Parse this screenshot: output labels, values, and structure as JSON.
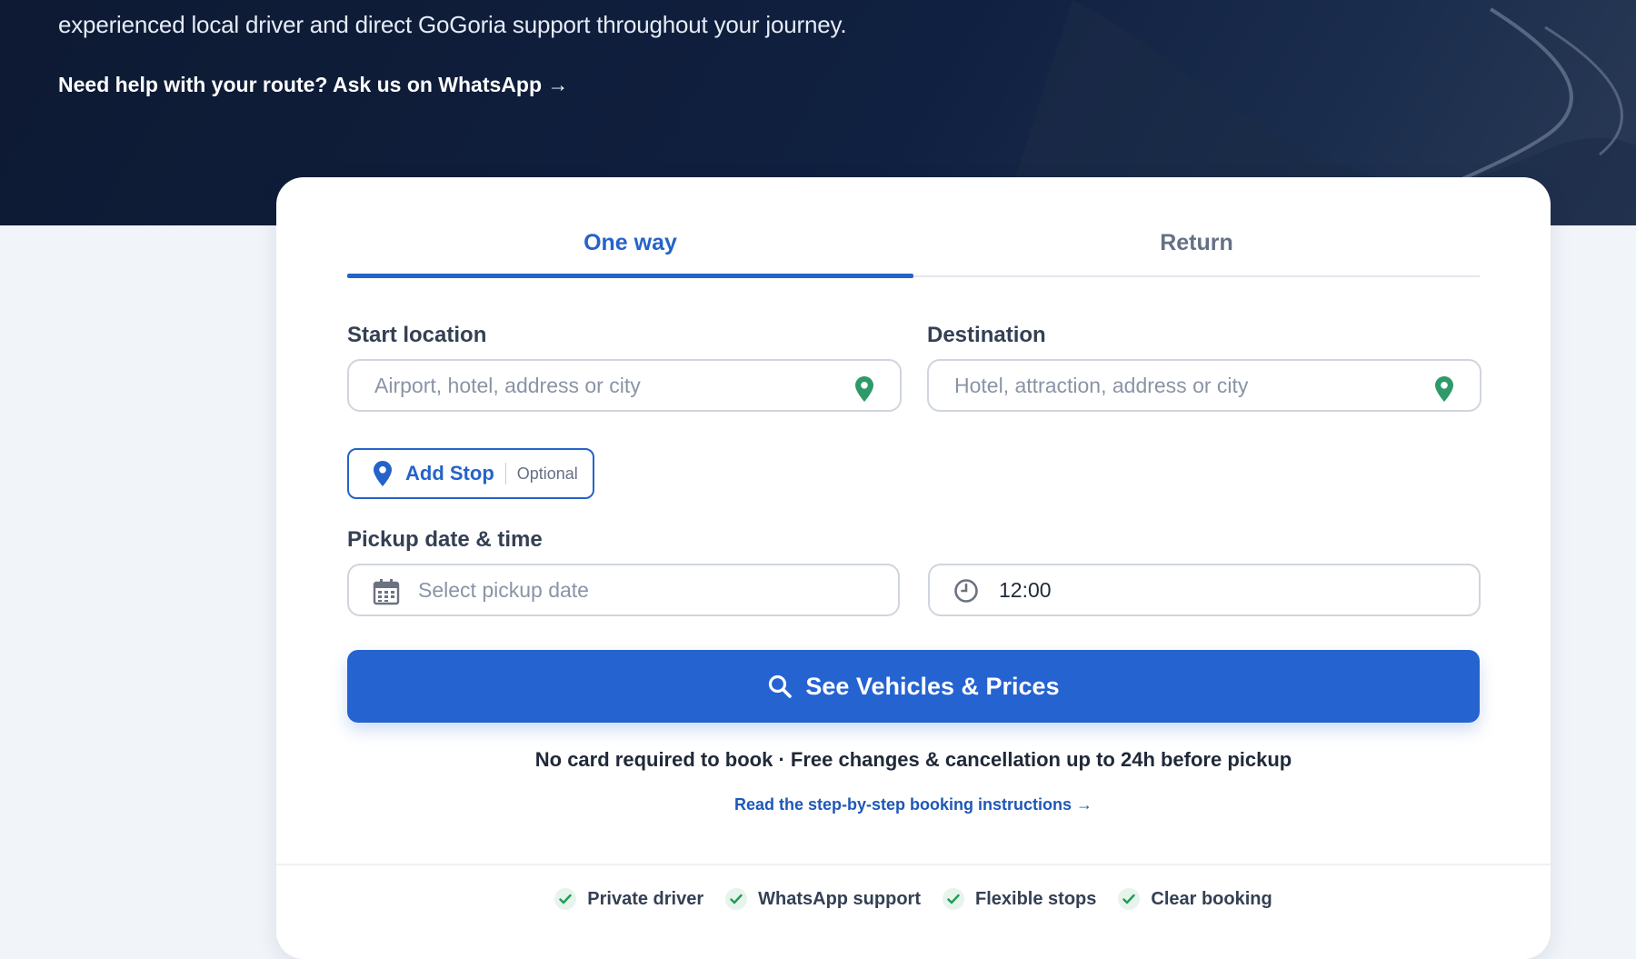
{
  "hero": {
    "text": "experienced local driver and direct GoGoria support throughout your journey.",
    "whatsapp_link": "Need help with your route? Ask us on WhatsApp →"
  },
  "tabs": [
    {
      "label": "One way",
      "active": true
    },
    {
      "label": "Return",
      "active": false
    }
  ],
  "form": {
    "start": {
      "label": "Start location",
      "placeholder": "Airport, hotel, address or city",
      "value": ""
    },
    "destination": {
      "label": "Destination",
      "placeholder": "Hotel, attraction, address or city",
      "value": ""
    },
    "add_stop": {
      "label": "Add Stop",
      "hint": "Optional"
    },
    "pickup": {
      "label": "Pickup date & time",
      "date_placeholder": "Select pickup date",
      "date_value": "",
      "time_value": "12:00"
    },
    "submit_label": "See Vehicles & Prices"
  },
  "note": "No card required to book · Free changes & cancellation up to 24h before pickup",
  "instructions_link": "Read the step-by-step booking instructions →",
  "features": [
    "Private driver",
    "WhatsApp support",
    "Flexible stops",
    "Clear booking"
  ],
  "colors": {
    "primary": "#2563d1",
    "accent_text": "#2563c9",
    "pin_green": "#2e9a6a",
    "hero_bg": "#0e1a33",
    "page_bg": "#f1f5fa"
  },
  "icons": {
    "location": "map-pin-icon",
    "calendar": "calendar-icon",
    "clock": "clock-icon",
    "search": "search-icon",
    "check": "check-icon"
  }
}
